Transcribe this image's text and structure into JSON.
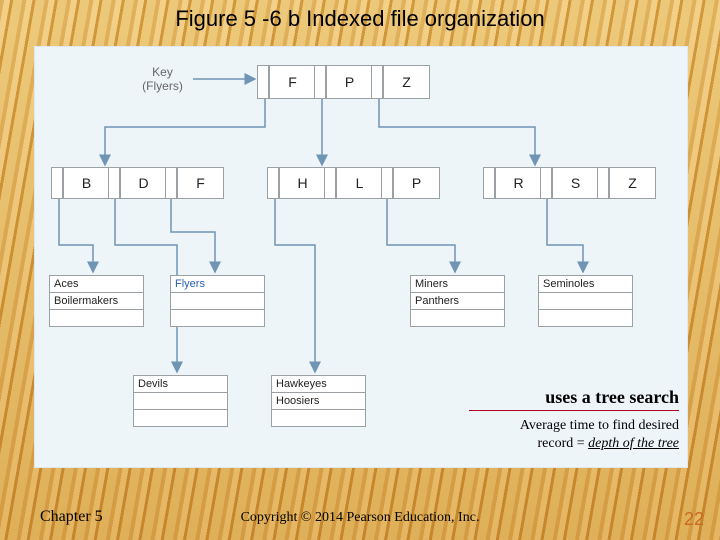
{
  "title": "Figure 5 -6 b Indexed file organization",
  "key_label_l1": "Key",
  "key_label_l2": "(Flyers)",
  "root": {
    "c0": "F",
    "c1": "P",
    "c2": "Z"
  },
  "level2": {
    "g0": {
      "c0": "B",
      "c1": "D",
      "c2": "F"
    },
    "g1": {
      "c0": "H",
      "c1": "L",
      "c2": "P"
    },
    "g2": {
      "c0": "R",
      "c1": "S",
      "c2": "Z"
    }
  },
  "leaves": {
    "l0": {
      "r0": "Aces",
      "r1": "Boilermakers",
      "r2": ""
    },
    "l1": {
      "r0": "Devils",
      "r1": "",
      "r2": ""
    },
    "l2": {
      "r0": "Flyers",
      "r1": "",
      "r2": ""
    },
    "l3": {
      "r0": "Hawkeyes",
      "r1": "Hoosiers",
      "r2": ""
    },
    "l4": {
      "r0": "Miners",
      "r1": "Panthers",
      "r2": ""
    },
    "l5": {
      "r0": "Seminoles",
      "r1": "",
      "r2": ""
    }
  },
  "note_line1": "uses a tree search",
  "note_line2a": "Average time to find desired",
  "note_line2b": "record = ",
  "note_depth": "depth of the tree",
  "footer_left": "Chapter 5",
  "footer_center": "Copyright © 2014 Pearson Education, Inc.",
  "footer_right": "22"
}
